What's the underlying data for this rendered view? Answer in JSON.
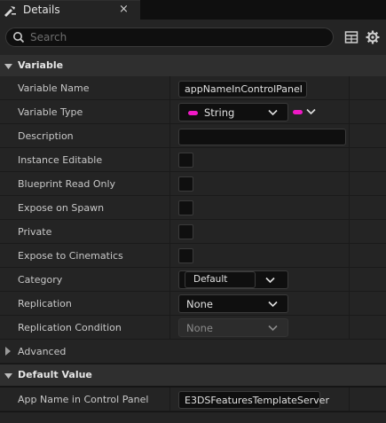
{
  "tab": {
    "title": "Details",
    "close": "×"
  },
  "search": {
    "placeholder": "Search",
    "value": ""
  },
  "sections": {
    "variable": "Variable",
    "default_value": "Default Value"
  },
  "properties": {
    "variable_name": {
      "label": "Variable Name",
      "value": "appNameInControlPanel"
    },
    "variable_type": {
      "label": "Variable Type",
      "value": "String",
      "pin_color": "#f019c6"
    },
    "description": {
      "label": "Description",
      "value": ""
    },
    "instance_editable": {
      "label": "Instance Editable",
      "checked": false
    },
    "blueprint_read_only": {
      "label": "Blueprint Read Only",
      "checked": false
    },
    "expose_on_spawn": {
      "label": "Expose on Spawn",
      "checked": false
    },
    "private": {
      "label": "Private",
      "checked": false
    },
    "expose_to_cinematics": {
      "label": "Expose to Cinematics",
      "checked": false
    },
    "category": {
      "label": "Category",
      "value": "Default"
    },
    "replication": {
      "label": "Replication",
      "value": "None"
    },
    "replication_condition": {
      "label": "Replication Condition",
      "value": "None"
    }
  },
  "advanced": {
    "label": "Advanced"
  },
  "default_value": {
    "label": "App Name in Control Panel",
    "value": "E3DSFeaturesTemplateServer"
  },
  "icons": {
    "tab": "details-icon",
    "search": "search-icon",
    "table_view": "table-view-icon",
    "settings": "gear-icon"
  }
}
